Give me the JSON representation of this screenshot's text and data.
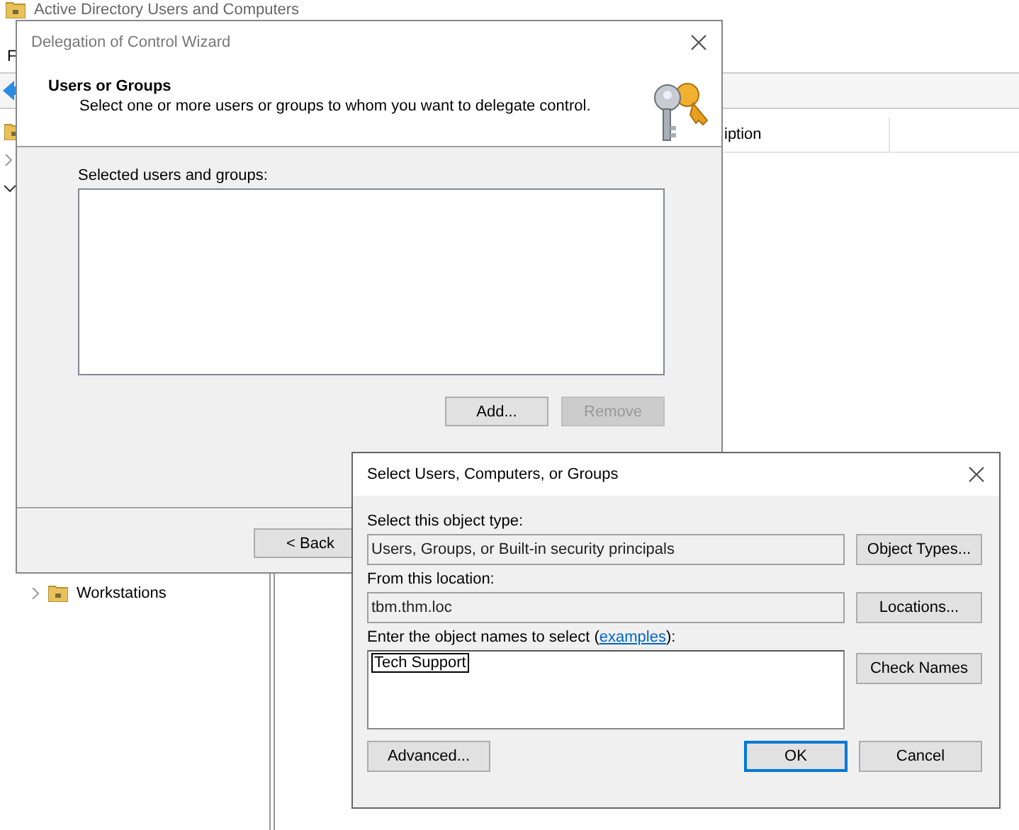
{
  "background_window": {
    "title": "Active Directory Users and Computers",
    "menu": [
      "F"
    ],
    "column_header": "iption",
    "tree": [
      {
        "label": "Workstations",
        "expanded": false
      }
    ]
  },
  "wizard": {
    "title": "Delegation of Control Wizard",
    "heading": "Users or Groups",
    "subtitle": "Select one or more users or groups to whom you want to delegate control.",
    "list_label": "Selected users and groups:",
    "buttons": [
      {
        "label": "Add...",
        "disabled": false
      },
      {
        "label": "Remove",
        "disabled": true
      }
    ],
    "nav_buttons": [
      {
        "label": "< Back"
      }
    ]
  },
  "select_dialog": {
    "title": "Select Users, Computers, or Groups",
    "object_type_label": "Select this object type:",
    "object_type": "Users, Groups, or Built-in security principals",
    "object_types_button": "Object Types...",
    "location_label": "From this location:",
    "location": "tbm.thm.loc",
    "locations_button": "Locations...",
    "names_label": {
      "before": "Enter the object names to select (",
      "link": "examples",
      "after": "):"
    },
    "names_value": "Tech Support",
    "check_names_button": "Check Names",
    "advanced_button": "Advanced...",
    "buttons": [
      {
        "label": "OK",
        "default": true
      },
      {
        "label": "Cancel",
        "default": false
      }
    ]
  }
}
